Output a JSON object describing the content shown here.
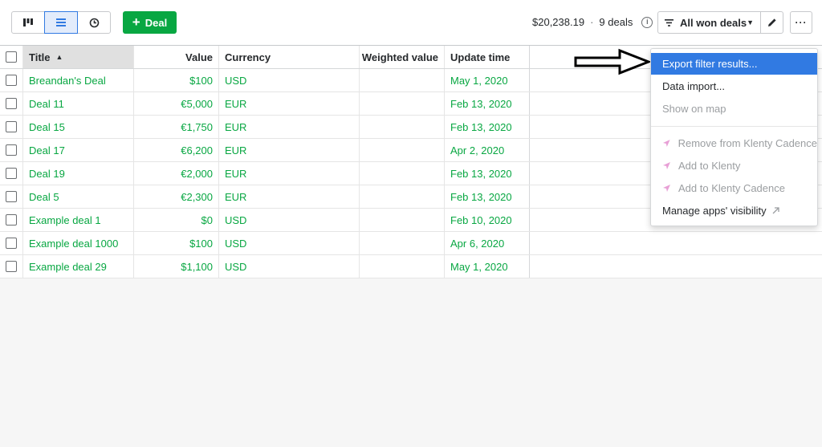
{
  "toolbar": {
    "views": [
      {
        "icon": "pipeline-icon",
        "active": false
      },
      {
        "icon": "list-icon",
        "active": true
      },
      {
        "icon": "forecast-icon",
        "active": false
      }
    ],
    "add_deal_label": "Deal",
    "summary_value": "$20,238.19",
    "summary_separator": "·",
    "summary_count": "9 deals",
    "filter_label": "All won deals",
    "more_label": "···"
  },
  "table": {
    "columns": [
      "Title",
      "Value",
      "Currency",
      "Weighted value",
      "Update time"
    ],
    "rows": [
      {
        "title": "Breandan's Deal",
        "value": "$100",
        "currency": "USD",
        "weighted": "",
        "update": "May 1, 2020"
      },
      {
        "title": "Deal 11",
        "value": "€5,000",
        "currency": "EUR",
        "weighted": "",
        "update": "Feb 13, 2020"
      },
      {
        "title": "Deal 15",
        "value": "€1,750",
        "currency": "EUR",
        "weighted": "",
        "update": "Feb 13, 2020"
      },
      {
        "title": "Deal 17",
        "value": "€6,200",
        "currency": "EUR",
        "weighted": "",
        "update": "Apr 2, 2020"
      },
      {
        "title": "Deal 19",
        "value": "€2,000",
        "currency": "EUR",
        "weighted": "",
        "update": "Feb 13, 2020"
      },
      {
        "title": "Deal 5",
        "value": "€2,300",
        "currency": "EUR",
        "weighted": "",
        "update": "Feb 13, 2020"
      },
      {
        "title": "Example deal 1",
        "value": "$0",
        "currency": "USD",
        "weighted": "",
        "update": "Feb 10, 2020"
      },
      {
        "title": "Example deal 1000",
        "value": "$100",
        "currency": "USD",
        "weighted": "",
        "update": "Apr 6, 2020"
      },
      {
        "title": "Example deal 29",
        "value": "$1,100",
        "currency": "USD",
        "weighted": "",
        "update": "May 1, 2020"
      }
    ]
  },
  "menu": {
    "export": "Export filter results...",
    "import": "Data import...",
    "map": "Show on map",
    "remove_klenty": "Remove from Klenty Cadence",
    "add_klenty": "Add to Klenty",
    "add_klenty_cadence": "Add to Klenty Cadence",
    "manage_apps": "Manage apps' visibility"
  },
  "colors": {
    "brand_green": "#08a742",
    "highlight_blue": "#317ae2",
    "app_icon_pink": "#e8a0d6"
  }
}
